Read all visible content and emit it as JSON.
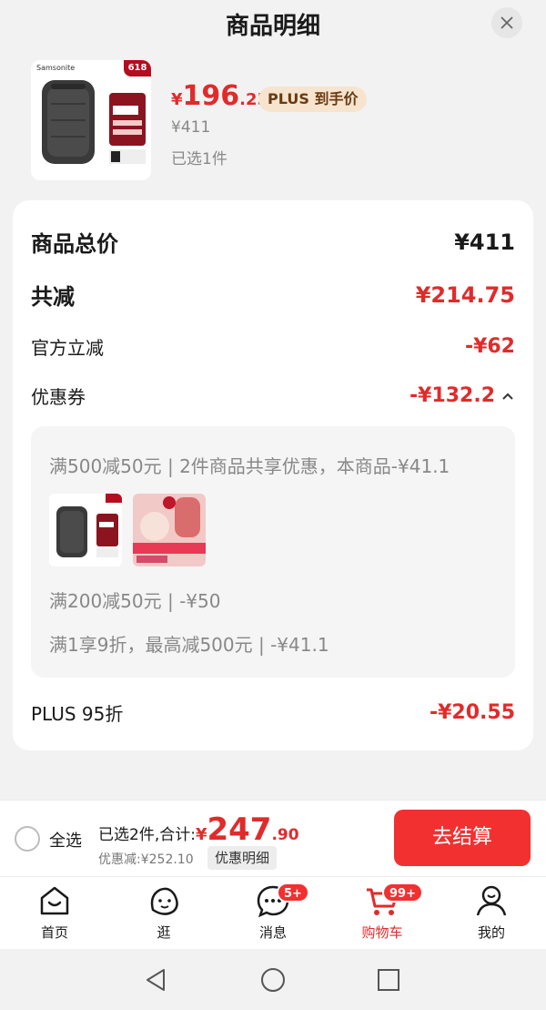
{
  "sheet": {
    "title": "商品明细"
  },
  "product": {
    "brand": "Samsonite",
    "badge": "618",
    "price_symbol": "¥",
    "price_int": "196",
    "price_dec": ".25",
    "plus_tag": "PLUS 到手价",
    "original_price": "¥411",
    "selected": "已选1件"
  },
  "summary": {
    "total_label": "商品总价",
    "total_value": "¥411",
    "reduce_label": "共减",
    "reduce_value": "¥214.75",
    "official_label": "官方立减",
    "official_value": "-¥62",
    "coupon_label": "优惠券",
    "coupon_value": "-¥132.2",
    "coupon_details": [
      "满500减50元 | 2件商品共享优惠，本商品-¥41.1",
      "满200减50元 | -¥50",
      "满1享9折，最高减500元 | -¥41.1"
    ],
    "plus_label": "PLUS 95折",
    "plus_value": "-¥20.55"
  },
  "checkout": {
    "select_all": "全选",
    "summary_text": "已选2件,合计:",
    "total_symbol": "¥",
    "total_int": "247",
    "total_dec": ".90",
    "discount_text": "优惠减:¥252.10",
    "detail_button": "优惠明细",
    "pay_button": "去结算"
  },
  "tabbar": {
    "items": [
      {
        "label": "首页",
        "icon": "home-icon"
      },
      {
        "label": "逛",
        "icon": "browse-icon"
      },
      {
        "label": "消息",
        "icon": "message-icon",
        "badge": "5+"
      },
      {
        "label": "购物车",
        "icon": "cart-icon",
        "badge": "99+",
        "active": true
      },
      {
        "label": "我的",
        "icon": "profile-icon"
      }
    ]
  },
  "colors": {
    "accent": "#e12b2b",
    "button": "#f23030",
    "plus_tag_bg": "#f7e4cf"
  }
}
